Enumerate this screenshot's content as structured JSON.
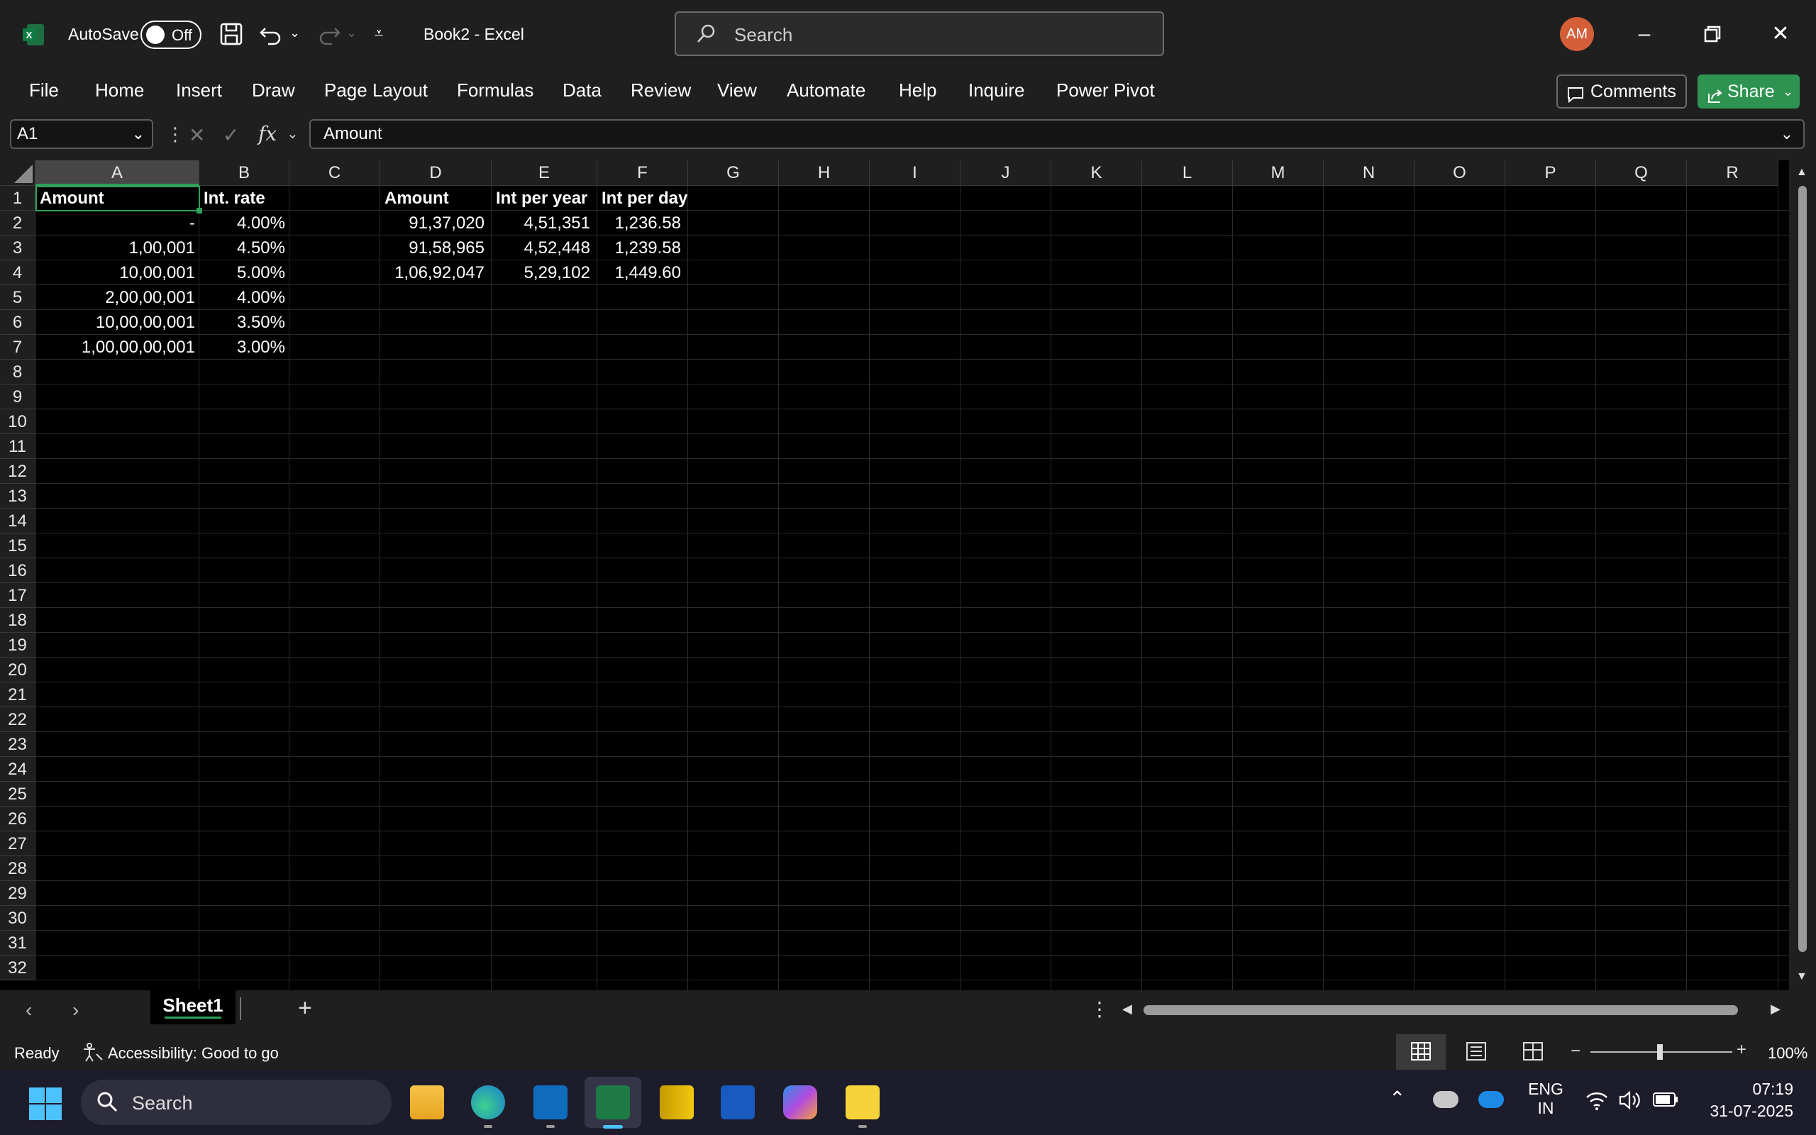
{
  "titlebar": {
    "autosave_label": "AutoSave",
    "autosave_state": "Off",
    "doc_title": "Book2  -  Excel",
    "search_placeholder": "Search",
    "avatar_initials": "AM"
  },
  "ribbon": {
    "tabs": [
      "File",
      "Home",
      "Insert",
      "Draw",
      "Page Layout",
      "Formulas",
      "Data",
      "Review",
      "View",
      "Automate",
      "Help",
      "Inquire",
      "Power Pivot"
    ],
    "comments_label": "Comments",
    "share_label": "Share"
  },
  "formula_bar": {
    "name_box": "A1",
    "content": "Amount"
  },
  "grid": {
    "columns": [
      "A",
      "B",
      "C",
      "D",
      "E",
      "F",
      "G",
      "H",
      "I",
      "J",
      "K",
      "L",
      "M",
      "N",
      "O",
      "P",
      "Q",
      "R"
    ],
    "rows": [
      "1",
      "2",
      "3",
      "4",
      "5",
      "6",
      "7",
      "8",
      "9",
      "10",
      "11",
      "12",
      "13",
      "14",
      "15",
      "16",
      "17",
      "18",
      "19",
      "20",
      "21",
      "22",
      "23",
      "24",
      "25",
      "26",
      "27",
      "28",
      "29",
      "30",
      "31",
      "32"
    ],
    "selected_cell": "A1",
    "table1": {
      "headers": [
        "Amount",
        "Int. rate"
      ],
      "rows": [
        [
          "-",
          "4.00%"
        ],
        [
          "1,00,001",
          "4.50%"
        ],
        [
          "10,00,001",
          "5.00%"
        ],
        [
          "2,00,00,001",
          "4.00%"
        ],
        [
          "10,00,00,001",
          "3.50%"
        ],
        [
          "1,00,00,00,001",
          "3.00%"
        ]
      ]
    },
    "table2": {
      "headers": [
        "Amount",
        "Int per year",
        "Int per day"
      ],
      "rows": [
        [
          "91,37,020",
          "4,51,351",
          "1,236.58"
        ],
        [
          "91,58,965",
          "4,52,448",
          "1,239.58"
        ],
        [
          "1,06,92,047",
          "5,29,102",
          "1,449.60"
        ]
      ]
    }
  },
  "sheets": {
    "tabs": [
      "Sheet1"
    ],
    "active": "Sheet1"
  },
  "status": {
    "ready": "Ready",
    "accessibility": "Accessibility: Good to go",
    "zoom": "100%"
  },
  "taskbar": {
    "search_placeholder": "Search",
    "lang_line1": "ENG",
    "lang_line2": "IN",
    "time": "07:19",
    "date": "31-07-2025"
  },
  "colors": {
    "excel_green": "#2e9350",
    "selection_green": "#2fa05a",
    "avatar": "#d35e38"
  }
}
